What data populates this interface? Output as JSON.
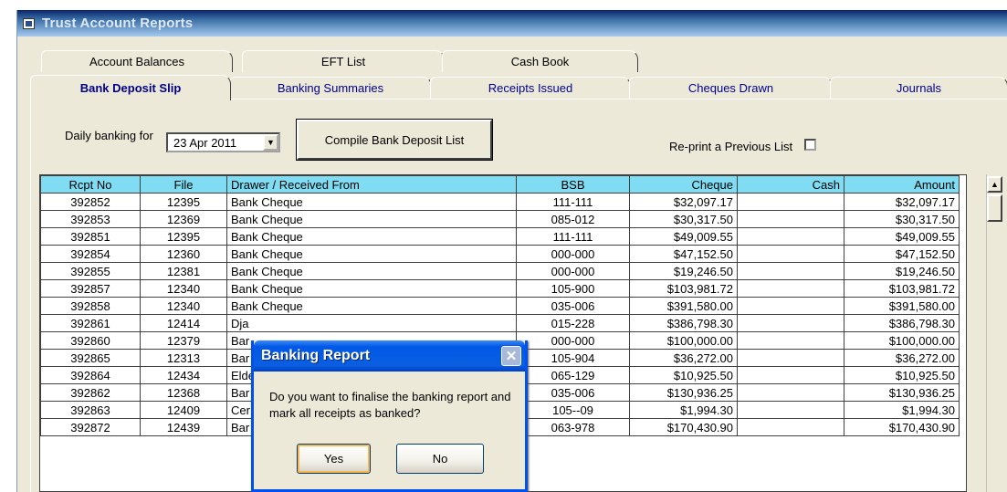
{
  "window": {
    "title": "Trust Account Reports"
  },
  "tabs_row1": [
    "Account Balances",
    "EFT List",
    "Cash Book"
  ],
  "tabs_row2": [
    "Bank Deposit Slip",
    "Banking Summaries",
    "Receipts Issued",
    "Cheques Drawn",
    "Journals"
  ],
  "active_tab": "Bank Deposit Slip",
  "controls": {
    "daily_label": "Daily banking for",
    "date_value": "23 Apr 2011",
    "compile_button": "Compile Bank Deposit List",
    "reprint_label": "Re-print a Previous List",
    "reprint_checked": false
  },
  "grid": {
    "columns": [
      "Rcpt No",
      "File",
      "Drawer / Received From",
      "BSB",
      "Cheque",
      "Cash",
      "Amount"
    ],
    "rows": [
      [
        "392852",
        "12395",
        "Bank Cheque",
        "111-111",
        "$32,097.17",
        "",
        "$32,097.17"
      ],
      [
        "392853",
        "12369",
        "Bank Cheque",
        "085-012",
        "$30,317.50",
        "",
        "$30,317.50"
      ],
      [
        "392851",
        "12395",
        "Bank Cheque",
        "111-111",
        "$49,009.55",
        "",
        "$49,009.55"
      ],
      [
        "392854",
        "12360",
        "Bank Cheque",
        "000-000",
        "$47,152.50",
        "",
        "$47,152.50"
      ],
      [
        "392855",
        "12381",
        "Bank Cheque",
        "000-000",
        "$19,246.50",
        "",
        "$19,246.50"
      ],
      [
        "392857",
        "12340",
        "Bank Cheque",
        "105-900",
        "$103,981.72",
        "",
        "$103,981.72"
      ],
      [
        "392858",
        "12340",
        "Bank Cheque",
        "035-006",
        "$391,580.00",
        "",
        "$391,580.00"
      ],
      [
        "392861",
        "12414",
        "Dja",
        "015-228",
        "$386,798.30",
        "",
        "$386,798.30"
      ],
      [
        "392860",
        "12379",
        "Bar",
        "000-000",
        "$100,000.00",
        "",
        "$100,000.00"
      ],
      [
        "392865",
        "12313",
        "Bar",
        "105-904",
        "$36,272.00",
        "",
        "$36,272.00"
      ],
      [
        "392864",
        "12434",
        "Elde",
        "065-129",
        "$10,925.50",
        "",
        "$10,925.50"
      ],
      [
        "392862",
        "12368",
        "Bar",
        "035-006",
        "$130,936.25",
        "",
        "$130,936.25"
      ],
      [
        "392863",
        "12409",
        "Cer",
        "105--09",
        "$1,994.30",
        "",
        "$1,994.30"
      ],
      [
        "392872",
        "12439",
        "Bar",
        "063-978",
        "$170,430.90",
        "",
        "$170,430.90"
      ]
    ]
  },
  "dialog": {
    "title": "Banking Report",
    "message": "Do you want to finalise the banking report and mark all receipts as banked?",
    "yes_label": "Yes",
    "no_label": "No"
  },
  "icons": {
    "app": "window-app-icon",
    "close": "close-icon",
    "dropdown": "chevron-down-icon",
    "scroll_up": "scroll-up-arrow-icon"
  }
}
